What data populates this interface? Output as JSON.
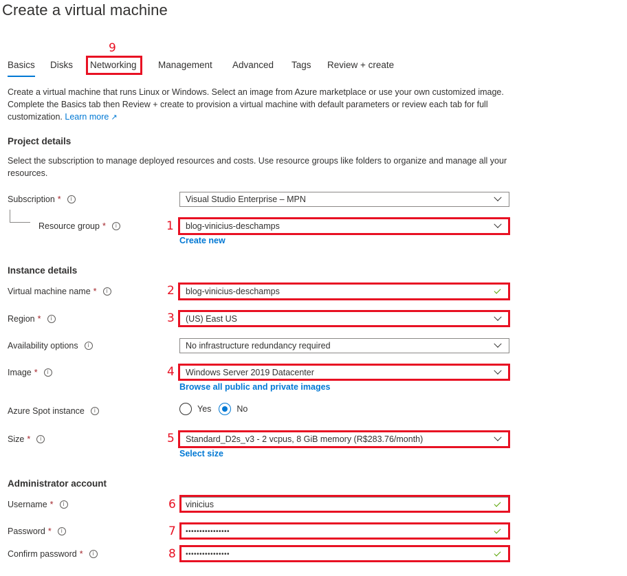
{
  "page": {
    "title": "Create a virtual machine"
  },
  "tabs": [
    {
      "label": "Basics",
      "active": true
    },
    {
      "label": "Disks",
      "active": false
    },
    {
      "label": "Networking",
      "active": false
    },
    {
      "label": "Management",
      "active": false
    },
    {
      "label": "Advanced",
      "active": false
    },
    {
      "label": "Tags",
      "active": false
    },
    {
      "label": "Review + create",
      "active": false
    }
  ],
  "intro": {
    "text": "Create a virtual machine that runs Linux or Windows. Select an image from Azure marketplace or use your own customized image. Complete the Basics tab then Review + create to provision a virtual machine with default parameters or review each tab for full customization.",
    "learn_more": "Learn more",
    "learn_more_icon": "external-link-icon"
  },
  "project_details": {
    "title": "Project details",
    "description": "Select the subscription to manage deployed resources and costs. Use resource groups like folders to organize and manage all your resources.",
    "subscription": {
      "label": "Subscription",
      "required_mark": "*",
      "value": "Visual Studio Enterprise – MPN"
    },
    "resource_group": {
      "label": "Resource group",
      "required_mark": "*",
      "value": "blog-vinicius-deschamps",
      "link": "Create new"
    }
  },
  "instance_details": {
    "title": "Instance details",
    "vm_name": {
      "label": "Virtual machine name",
      "required_mark": "*",
      "value": "blog-vinicius-deschamps",
      "valid": true
    },
    "region": {
      "label": "Region",
      "required_mark": "*",
      "value": "(US) East US"
    },
    "availability": {
      "label": "Availability options",
      "value": "No infrastructure redundancy required"
    },
    "image": {
      "label": "Image",
      "required_mark": "*",
      "value": "Windows Server 2019 Datacenter",
      "link": "Browse all public and private images"
    },
    "spot": {
      "label": "Azure Spot instance",
      "options": [
        "Yes",
        "No"
      ],
      "selected": "No"
    },
    "size": {
      "label": "Size",
      "required_mark": "*",
      "value": "Standard_D2s_v3 - 2 vcpus, 8 GiB memory (R$283.76/month)",
      "link": "Select size"
    }
  },
  "admin_account": {
    "title": "Administrator account",
    "username": {
      "label": "Username",
      "required_mark": "*",
      "value": "vinicius",
      "valid": true
    },
    "password": {
      "label": "Password",
      "required_mark": "*",
      "value": "••••••••••••••••",
      "valid": true
    },
    "confirm_password": {
      "label": "Confirm password",
      "required_mark": "*",
      "value": "••••••••••••••••",
      "valid": true
    }
  },
  "annotations": {
    "color": "#e81123",
    "numbers": [
      "1",
      "2",
      "3",
      "4",
      "5",
      "6",
      "7",
      "8",
      "9"
    ]
  },
  "info_glyph": "i",
  "colors": {
    "accent": "#0078d4",
    "required": "#a4262c",
    "valid": "#57a300",
    "annotation": "#e81123"
  }
}
